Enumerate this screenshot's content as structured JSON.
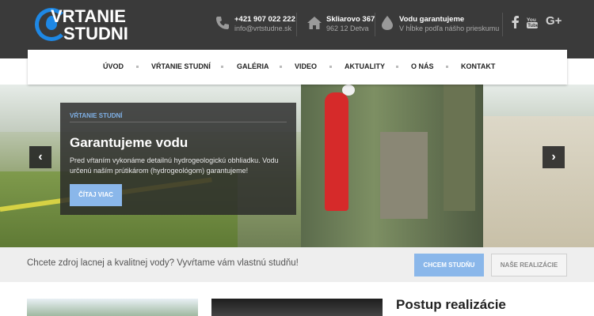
{
  "brand": {
    "logo_line1": "VRTANIE",
    "logo_line2": "STUDNI",
    "accent": "#1e88e5"
  },
  "header": {
    "phone": {
      "icon": "phone-icon",
      "line1": "+421 907 022 222",
      "line2": "info@vrtstudne.sk"
    },
    "address": {
      "icon": "home-icon",
      "line1": "Skliarovo 367",
      "line2": "962 12 Detva"
    },
    "guarantee": {
      "icon": "water-drop-icon",
      "line1": "Vodu garantujeme",
      "line2": "V hĺbke podľa nášho prieskumu"
    },
    "social": [
      "facebook-icon",
      "youtube-icon",
      "google-plus-icon"
    ]
  },
  "nav": {
    "items": [
      "ÚVOD",
      "VŔTANIE STUDNÍ",
      "GALÉRIA",
      "VIDEO",
      "AKTUALITY",
      "O NÁS",
      "KONTAKT"
    ]
  },
  "slide": {
    "category": "VŔTANIE STUDNÍ",
    "title": "Garantujeme vodu",
    "text": "Pred vŕtaním vykonáme detailnú hydrogeologickú obhliadku. Vodu určenú naším prútikárom (hydrogeológom) garantujeme!",
    "button": "ČÍTAJ VIAC",
    "prev": "‹",
    "next": "›"
  },
  "cta": {
    "text": "Chcete zdroj lacnej a kvalitnej vody? Vyvŕtame vám vlastnú studňu!",
    "primary": "CHCEM STUDŇU",
    "secondary": "NAŠE REALIZÁCIE"
  },
  "content": {
    "section_title": "Postup realizácie"
  },
  "colors": {
    "header_bg": "#3a3a3a",
    "button_blue": "#8ab7ea"
  }
}
